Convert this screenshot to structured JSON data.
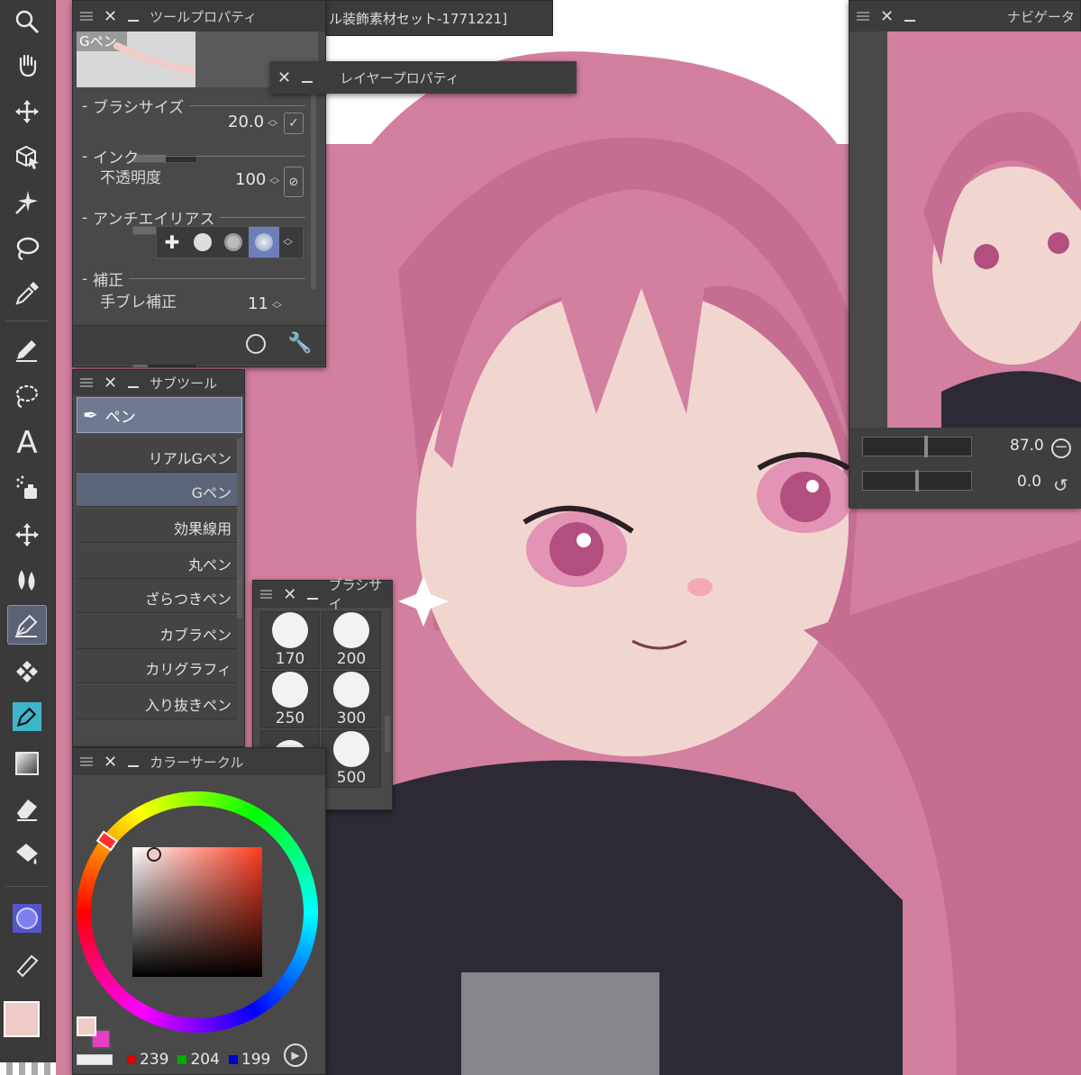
{
  "tool_property": {
    "title": "ツールプロパティ",
    "preview_label": "Gペン",
    "brush_size_label": "ブラシサイズ",
    "brush_size_value": "20.0",
    "ink_label": "インク",
    "opacity_label": "不透明度",
    "opacity_value": "100",
    "antialias_label": "アンチエイリアス",
    "correction_label": "補正",
    "stabilization_label": "手ブレ補正",
    "stabilization_value": "11"
  },
  "canvas_tab": {
    "title": "ル装飾素材セット-1771221]"
  },
  "layer_property": {
    "title": "レイヤープロパティ"
  },
  "navigator": {
    "title": "ナビゲータ",
    "zoom_value": "87.0",
    "rotate_value": "0.0"
  },
  "sub_tool": {
    "title": "サブツール",
    "group_label": "ペン",
    "brushes": [
      {
        "label": "リアルGペン"
      },
      {
        "label": "Gペン"
      },
      {
        "label": "効果線用"
      },
      {
        "label": "丸ペン"
      },
      {
        "label": "ざらつきペン"
      },
      {
        "label": "カブラペン"
      },
      {
        "label": "カリグラフィ"
      },
      {
        "label": "入り抜きペン"
      }
    ]
  },
  "brush_size_panel": {
    "title": "ブラシサイ",
    "sizes": [
      "170",
      "200",
      "250",
      "300",
      "",
      "500"
    ]
  },
  "color_circle": {
    "title": "カラーサークル",
    "r": "239",
    "g": "204",
    "b": "199"
  },
  "colors": {
    "main": "#efccc7",
    "sub": "#e63fc6",
    "hair": "#d27fa0",
    "ui_bg": "#494949",
    "selected": "#5d6678"
  },
  "icons": [
    "zoom-icon",
    "hand-icon",
    "move-icon",
    "object-icon",
    "auto-select-icon",
    "lasso-icon",
    "eyedropper-icon",
    "pen-icon",
    "lasso-fill-icon",
    "text-icon",
    "airbrush-icon",
    "move-layer-icon",
    "blend-icon",
    "pen-tool-icon",
    "decoration-icon",
    "pen-color-icon",
    "gradient-icon",
    "eraser-icon",
    "fill-icon",
    "ruler-circle-icon",
    "ruler-icon"
  ]
}
